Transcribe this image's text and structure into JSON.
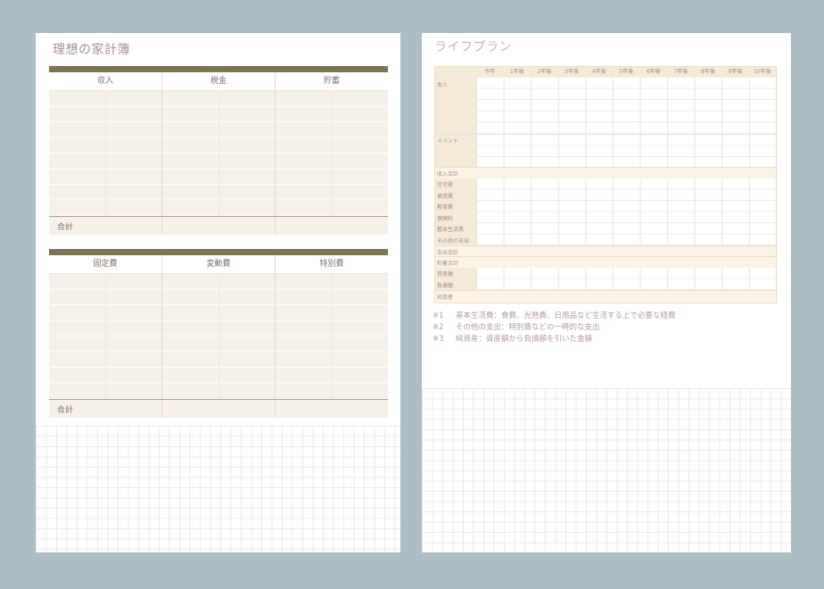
{
  "left_page": {
    "title": "理想の家計簿",
    "income_table": {
      "headers": [
        "収入",
        "税金",
        "貯蓄"
      ],
      "total_label": "合計"
    },
    "expense_table": {
      "headers": [
        "固定費",
        "変動費",
        "特別費"
      ],
      "total_label": "合計"
    }
  },
  "right_page": {
    "title": "ライフプラン",
    "year_headers": [
      "今年",
      "1年後",
      "2年後",
      "3年後",
      "4年後",
      "5年後",
      "6年後",
      "7年後",
      "8年後",
      "9年後",
      "10年後"
    ],
    "row_labels": {
      "person": "本人",
      "event": "イベント",
      "income_total": "収入合計",
      "housing": "住宅費",
      "car": "車両費",
      "education": "教育費",
      "insurance": "保険料",
      "basic_living": "基本生活費",
      "other_spending": "その他の支出",
      "spending_total": "支出合計",
      "savings_total": "貯蓄合計",
      "assets": "資産額",
      "liabilities": "負債額",
      "net_assets": "純資産"
    },
    "notes": [
      {
        "mark": "※1",
        "text": "基本生活費：食費、光熱費、日用品など生活する上で必要な経費"
      },
      {
        "mark": "※2",
        "text": "その他の支出：特別費などの一時的な支出"
      },
      {
        "mark": "※3",
        "text": "純資産：資産額から負債額を引いた金額"
      }
    ]
  }
}
